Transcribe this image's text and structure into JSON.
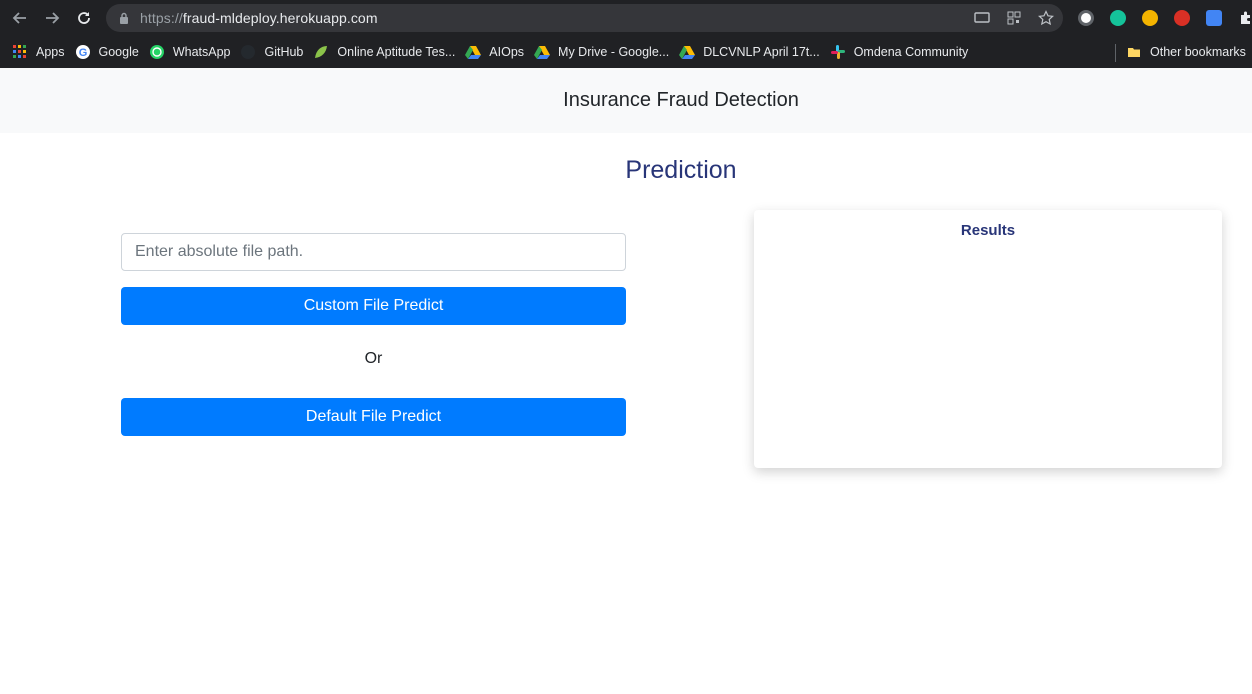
{
  "browser": {
    "url_scheme": "https://",
    "url_host": "fraud-mldeploy.herokuapp.com",
    "bookmarks": [
      {
        "label": "Apps",
        "icon": "apps-grid-icon"
      },
      {
        "label": "Google",
        "icon": "google-icon"
      },
      {
        "label": "WhatsApp",
        "icon": "whatsapp-icon"
      },
      {
        "label": "GitHub",
        "icon": "github-icon"
      },
      {
        "label": "Online Aptitude Tes...",
        "icon": "leaf-icon"
      },
      {
        "label": "AIOps",
        "icon": "drive-icon"
      },
      {
        "label": "My Drive - Google...",
        "icon": "drive-icon"
      },
      {
        "label": "DLCVNLP April 17t...",
        "icon": "drive-icon"
      },
      {
        "label": "Omdena Community",
        "icon": "slack-icon"
      }
    ],
    "other_bookmarks": "Other bookmarks"
  },
  "page": {
    "brand": "Insurance Fraud Detection",
    "heading": "Prediction",
    "file_input_placeholder": "Enter absolute file path.",
    "custom_button": "Custom File Predict",
    "or_text": "Or",
    "default_button": "Default File Predict",
    "results_title": "Results"
  },
  "colors": {
    "primary": "#007bff",
    "heading": "#283578",
    "navbar_bg": "#f8f9fa",
    "chrome_bg": "#202124"
  }
}
